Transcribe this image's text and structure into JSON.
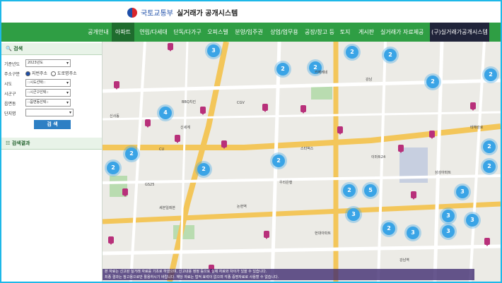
{
  "header": {
    "org_name": "국토교통부",
    "system_name": "실거래가 공개시스템"
  },
  "nav": {
    "items": [
      {
        "label": "공개안내",
        "active": false
      },
      {
        "label": "아파트",
        "active": true
      },
      {
        "label": "연립/다세대",
        "active": false
      },
      {
        "label": "단독/다가구",
        "active": false
      },
      {
        "label": "오피스텔",
        "active": false
      },
      {
        "label": "분양/입주권",
        "active": false
      },
      {
        "label": "상업/업무용",
        "active": false
      },
      {
        "label": "공장/창고 등",
        "active": false
      },
      {
        "label": "토지",
        "active": false
      },
      {
        "label": "게시판",
        "active": false
      },
      {
        "label": "실거래가 자료제공",
        "active": false
      },
      {
        "label": "(구)실거래가공개시스템",
        "active": false
      }
    ]
  },
  "search_panel": {
    "title": "검색",
    "fields": [
      {
        "label": "기준년도",
        "value": "2023년도"
      },
      {
        "label": "주소구분",
        "option_a": "지번주소",
        "option_b": "도로명주소"
      },
      {
        "label": "시도",
        "value": "::시도선택::"
      },
      {
        "label": "시군구",
        "value": "::시군구선택::"
      },
      {
        "label": "읍면동",
        "value": "::읍면동선택::"
      },
      {
        "label": "단지명",
        "value": ""
      }
    ],
    "submit_label": "검 색"
  },
  "results_panel": {
    "title": "검색결과"
  },
  "map": {
    "clusters": [
      "2",
      "2",
      "2",
      "2",
      "2",
      "4",
      "2",
      "2",
      "2",
      "2",
      "2",
      "5",
      "3",
      "3",
      "2",
      "3",
      "3",
      "3",
      "3",
      "2",
      "2",
      "3",
      "2"
    ],
    "labels": [
      "BBQ치킨",
      "CGV",
      "GS25",
      "카페베네",
      "신사동",
      "논현역",
      "강남",
      "세븐일레븐",
      "신세계",
      "CU",
      "스타벅스",
      "이마트24",
      "우리은행",
      "현대아파트",
      "삼성아파트",
      "테헤란로",
      "강남역"
    ]
  },
  "notice": {
    "line1": "본 자료는 신고된 실거래 자료를 기초로 하였으며, 신고내용 정정 등으로 실제 자료와 차이가 있을 수 있습니다.",
    "line2": "최종 결과는 참고용으로만 활용하시기 바랍니다. 해당 자료는 법적 효력이 없으며 각종 증명자료로 사용할 수 없습니다."
  }
}
